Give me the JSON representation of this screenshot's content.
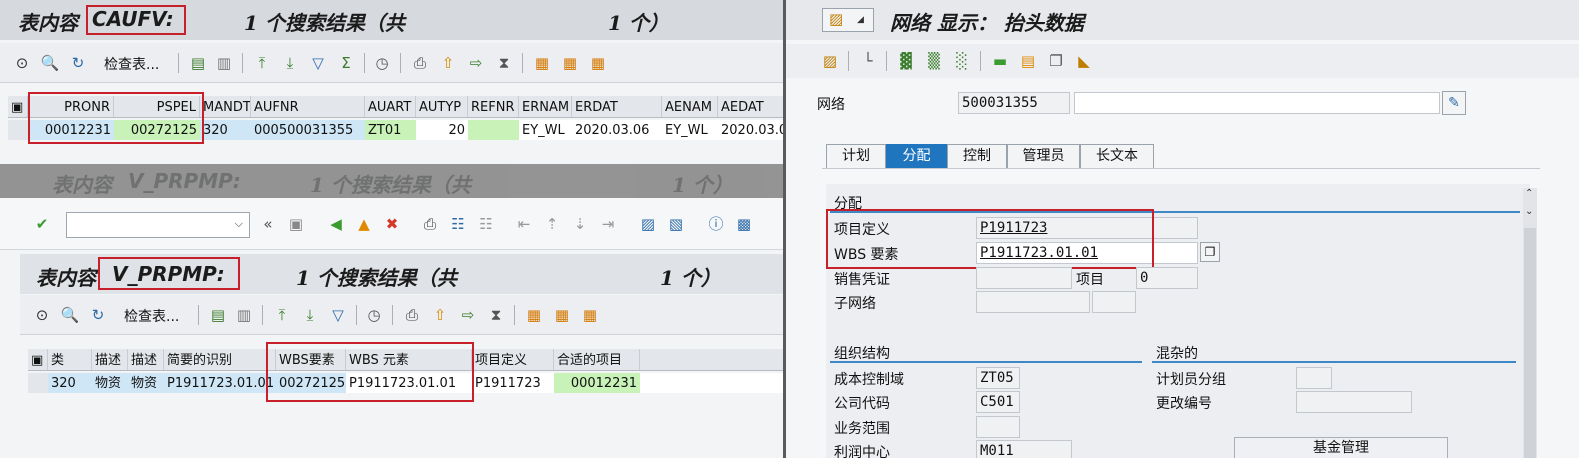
{
  "left": {
    "caufv": {
      "title_prefix": "表内容",
      "table_name": "CAUFV:",
      "count_prefix": "1 个搜索结果（共",
      "count_suffix": "1 个）",
      "check_table_label": "检查表...",
      "headers": [
        "PRONR",
        "PSPEL",
        "MANDT",
        "AUFNR",
        "AUART",
        "AUTYP",
        "REFNR",
        "ERNAM",
        "ERDAT",
        "AENAM",
        "AEDAT"
      ],
      "row": [
        "00012231",
        "00272125",
        "320",
        "000500031355",
        "ZT01",
        "20",
        "",
        "EY_WL",
        "2020.03.06",
        "EY_WL",
        "2020.03.0"
      ]
    },
    "faded": {
      "title_prefix": "表内容",
      "table_name": "V_PRPMP:",
      "count_prefix": "1 个搜索结果（共",
      "count_suffix": "1 个）"
    },
    "vprpmp": {
      "title_prefix": "表内容",
      "table_name": "V_PRPMP:",
      "count_prefix": "1 个搜索结果（共",
      "count_suffix": "1 个）",
      "check_table_label": "检查表...",
      "headers": [
        "类",
        "描述",
        "描述",
        "简要的识别",
        "WBS要素",
        "WBS 元素",
        "项目定义",
        "合适的项目"
      ],
      "row": [
        "320",
        "物资",
        "物资",
        "P1911723.01.01",
        "00272125",
        "P1911723.01.01",
        "P1911723",
        "00012231"
      ]
    }
  },
  "right": {
    "title": "网络 显示： 抬头数据",
    "network_label": "网络",
    "network_value": "500031355",
    "tabs": [
      "计划",
      "分配",
      "控制",
      "管理员",
      "长文本"
    ],
    "active_tab": "分配",
    "section_assignment": "分配",
    "project_def_label": "项目定义",
    "project_def_value": "P1911723",
    "wbs_label": "WBS 要素",
    "wbs_value": "P1911723.01.01",
    "sales_doc_label": "销售凭证",
    "item_label": "项目",
    "item_value": "0",
    "sub_network_label": "子网络",
    "section_org": "组织结构",
    "section_misc": "混杂的",
    "controlling_area_label": "成本控制域",
    "controlling_area_value": "ZT05",
    "company_code_label": "公司代码",
    "company_code_value": "C501",
    "business_area_label": "业务范围",
    "profit_center_label": "利润中心",
    "profit_center_value": "M011",
    "planner_group_label": "计划员分组",
    "change_number_label": "更改编号",
    "fund_button_label": "基金管理"
  },
  "colors": {
    "highlight_red": "#c8202a",
    "tab_active": "#1f76bf",
    "cell_blue": "#cfe6f6",
    "cell_green": "#c9f2b8"
  }
}
